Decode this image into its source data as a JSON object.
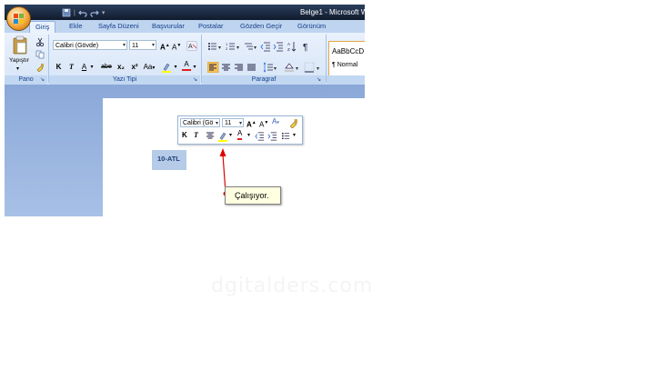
{
  "window": {
    "title": "Belge1 - Microsoft W"
  },
  "tabs": [
    "Giriş",
    "Ekle",
    "Sayfa Düzeni",
    "Başvurular",
    "Postalar",
    "Gözden Geçir",
    "Görünüm"
  ],
  "ribbon": {
    "paste_label": "Yapıştır",
    "font_name": "Calibri (Gövde)",
    "font_size": "11",
    "bold": "K",
    "italic": "T",
    "underline": "A",
    "strike": "abe",
    "sub": "x₂",
    "sup": "x²",
    "case": "Aa",
    "grow": "A",
    "shrink": "A",
    "style_preview": "AaBbCcD",
    "style_name": "¶ Normal",
    "groups": {
      "clipboard": "Pano",
      "font": "Yazı Tipi",
      "paragraph": "Paragraf"
    }
  },
  "document": {
    "selected_text": "10-ATL"
  },
  "mini_toolbar": {
    "font_name": "Calibri (Gö",
    "font_size": "11",
    "bold": "K",
    "italic": "T"
  },
  "callout": {
    "text": "Çalışıyor."
  },
  "watermark": "dgitalders.com",
  "colors": {
    "title_bar": "#1b2a44",
    "ribbon": "#dfeaf9",
    "highlight": "#ffff00",
    "font_color": "#e02020",
    "arrow": "#e00000"
  }
}
